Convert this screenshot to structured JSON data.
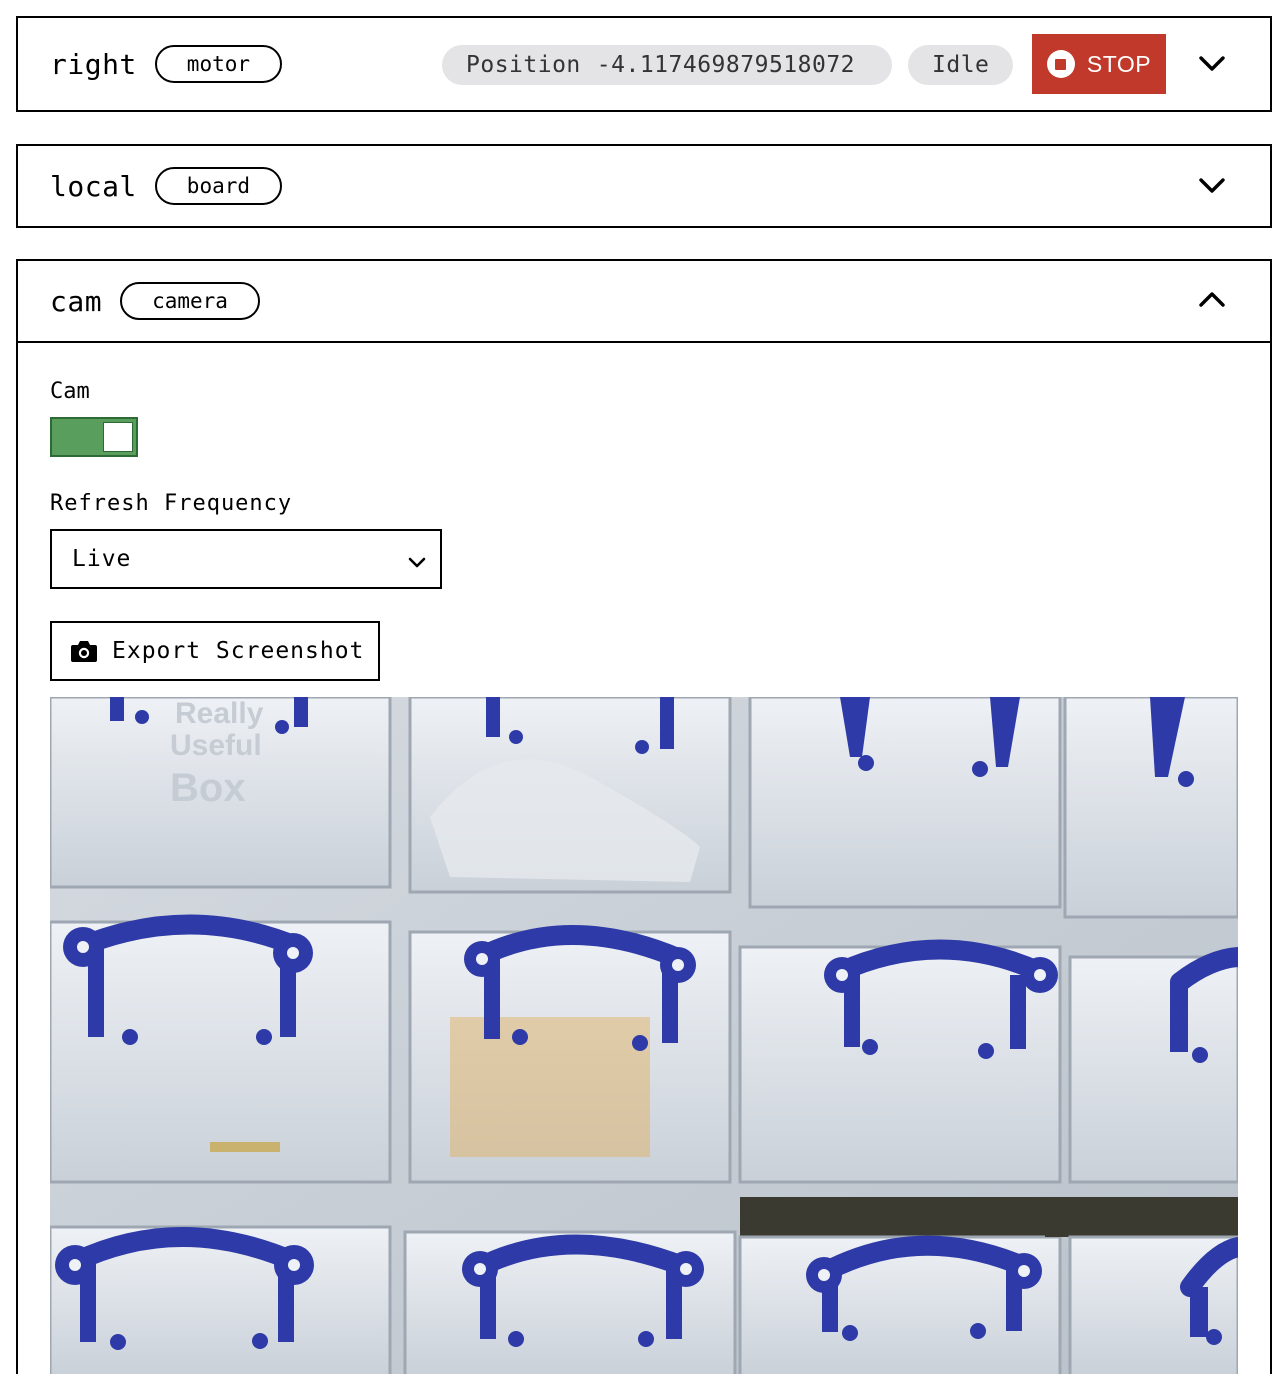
{
  "cards": {
    "motor": {
      "name": "right",
      "type": "motor",
      "position_label": "Position",
      "position_value": "-4.117469879518072",
      "status": "Idle",
      "stop_label": "STOP"
    },
    "board": {
      "name": "local",
      "type": "board"
    },
    "camera": {
      "name": "cam",
      "type": "camera",
      "toggle_label": "Cam",
      "toggle_on": true,
      "refresh_label": "Refresh Frequency",
      "refresh_value": "Live",
      "export_label": "Export Screenshot",
      "feed_print": [
        "Really",
        "Useful",
        "Box"
      ]
    }
  },
  "icons": {
    "collapse": "chevron-down-icon",
    "expand": "chevron-up-icon",
    "stop": "stop-circle-icon",
    "camera": "camera-icon"
  },
  "colors": {
    "stop": "#c0392b",
    "toggle_on": "#5a9e5e",
    "tag_bg": "#e4e4e6",
    "handle": "#2e3aa8"
  }
}
